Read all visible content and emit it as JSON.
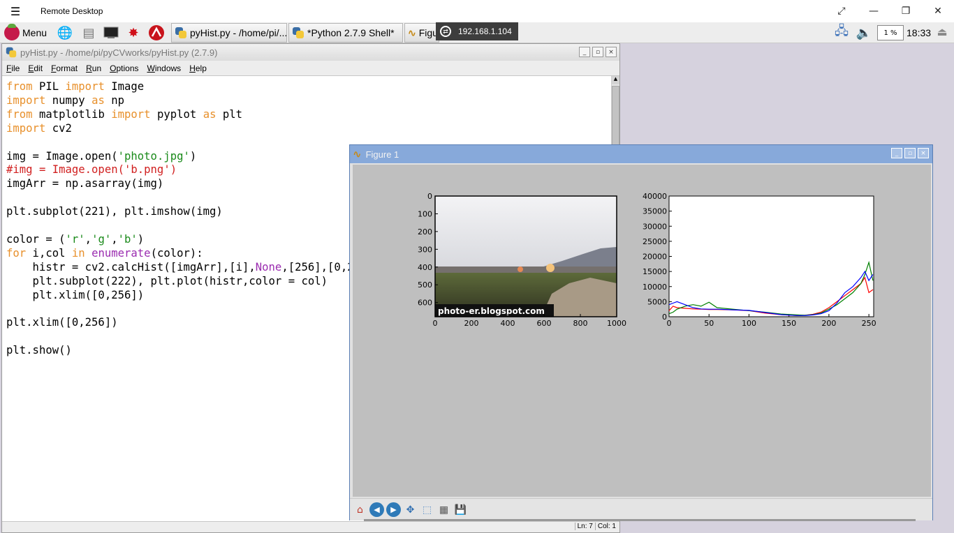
{
  "remote_desktop": {
    "title": "Remote Desktop",
    "menu_icon": "hamburger-icon",
    "controls": [
      "expand-icon",
      "minimize-icon",
      "restore-icon",
      "close-icon"
    ]
  },
  "taskbar": {
    "menu_label": "Menu",
    "launchers": [
      "web-browser-icon",
      "file-manager-icon",
      "terminal-icon",
      "mathematica-icon",
      "wolfram-icon"
    ],
    "tasks": [
      {
        "label": "pyHist.py - /home/pi/..."
      },
      {
        "label": "*Python 2.7.9 Shell*"
      },
      {
        "label": "Figu"
      }
    ],
    "ip_address": "192.168.1.104",
    "cpu": "1 %",
    "clock": "18:33",
    "tray_icons": [
      "network-icon",
      "volume-icon",
      "eject-icon"
    ]
  },
  "editor": {
    "title": "pyHist.py - /home/pi/pyCVworks/pyHist.py (2.7.9)",
    "menu": [
      "File",
      "Edit",
      "Format",
      "Run",
      "Options",
      "Windows",
      "Help"
    ],
    "status": {
      "line": "Ln: 7",
      "col": "Col: 1"
    }
  },
  "figure": {
    "title": "Figure 1",
    "toolbar": [
      "home-icon",
      "back-icon",
      "forward-icon",
      "pan-icon",
      "zoom-icon",
      "subplots-icon",
      "save-icon"
    ]
  },
  "chart_data": [
    {
      "type": "image",
      "caption": "photo-er.blogspot.com",
      "x_ticks": [
        "0",
        "200",
        "400",
        "600",
        "800",
        "1000"
      ],
      "y_ticks": [
        "0",
        "100",
        "200",
        "300",
        "400",
        "500",
        "600"
      ],
      "xlim": [
        0,
        1000
      ],
      "ylim": [
        680,
        0
      ]
    },
    {
      "type": "line",
      "xlim": [
        0,
        256
      ],
      "ylim": [
        0,
        40000
      ],
      "x_ticks": [
        "0",
        "50",
        "100",
        "150",
        "200",
        "250"
      ],
      "y_ticks": [
        "0",
        "5000",
        "10000",
        "15000",
        "20000",
        "25000",
        "30000",
        "35000",
        "40000"
      ],
      "series": [
        {
          "color": "#ff0000",
          "x": [
            0,
            5,
            10,
            20,
            30,
            40,
            50,
            60,
            80,
            100,
            120,
            140,
            160,
            170,
            180,
            190,
            200,
            210,
            220,
            230,
            240,
            245,
            250,
            255
          ],
          "y": [
            2000,
            3500,
            3000,
            2800,
            2600,
            2500,
            2400,
            2400,
            2300,
            2000,
            1200,
            700,
            400,
            500,
            800,
            1500,
            3000,
            5000,
            7000,
            9000,
            11000,
            13000,
            8000,
            9000
          ]
        },
        {
          "color": "#008000",
          "x": [
            0,
            5,
            10,
            20,
            30,
            40,
            50,
            60,
            80,
            100,
            120,
            140,
            160,
            170,
            180,
            190,
            200,
            210,
            220,
            230,
            240,
            245,
            250,
            255
          ],
          "y": [
            1000,
            1500,
            2500,
            3500,
            4000,
            3500,
            4800,
            3000,
            2500,
            2000,
            1500,
            900,
            600,
            500,
            700,
            1200,
            2500,
            4000,
            6000,
            8000,
            11000,
            14000,
            18000,
            12000
          ]
        },
        {
          "color": "#0000ff",
          "x": [
            0,
            5,
            10,
            20,
            30,
            40,
            50,
            60,
            80,
            100,
            120,
            140,
            160,
            170,
            180,
            190,
            200,
            210,
            220,
            230,
            240,
            245,
            250,
            255
          ],
          "y": [
            4000,
            4500,
            5000,
            4000,
            3000,
            2600,
            2500,
            2500,
            2300,
            2100,
            1400,
            700,
            400,
            400,
            600,
            1000,
            2000,
            4500,
            8000,
            10000,
            13000,
            15000,
            12000,
            14000
          ]
        }
      ]
    }
  ]
}
